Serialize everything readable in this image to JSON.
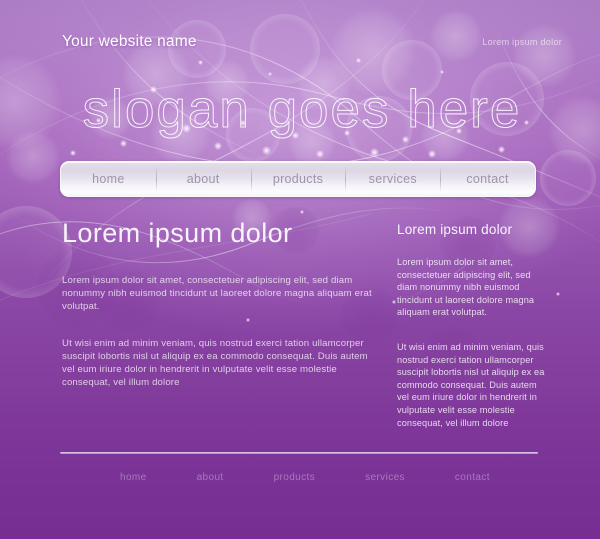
{
  "header": {
    "site_name": "Your website name",
    "tagline": "Lorem ipsum dolor"
  },
  "hero": {
    "slogan": "slogan goes here"
  },
  "nav": {
    "items": [
      {
        "label": "home"
      },
      {
        "label": "about"
      },
      {
        "label": "products"
      },
      {
        "label": "services"
      },
      {
        "label": "contact"
      }
    ]
  },
  "main": {
    "left": {
      "heading": "Lorem ipsum dolor",
      "paragraph_1": "Lorem ipsum dolor sit amet, consectetuer adipiscing elit, sed diam nonummy nibh euismod tincidunt ut laoreet dolore magna aliquam erat volutpat.",
      "paragraph_2": "Ut wisi enim ad minim veniam, quis nostrud exerci tation ullamcorper suscipit lobortis nisl ut aliquip ex ea commodo consequat. Duis autem vel eum iriure dolor in hendrerit in vulputate velit esse molestie consequat, vel illum dolore"
    },
    "right": {
      "heading": "Lorem ipsum dolor",
      "paragraph_1": "Lorem ipsum dolor sit amet, consectetuer adipiscing elit, sed diam nonummy nibh euismod tincidunt ut laoreet dolore magna aliquam erat volutpat.",
      "paragraph_2": "Ut wisi enim ad minim veniam, quis nostrud exerci tation ullamcorper suscipit lobortis nisl ut aliquip ex ea commodo consequat. Duis autem vel eum iriure dolor in hendrerit in vulputate velit esse molestie consequat, vel illum dolore"
    }
  },
  "footer": {
    "items": [
      {
        "label": "home"
      },
      {
        "label": "about"
      },
      {
        "label": "products"
      },
      {
        "label": "services"
      },
      {
        "label": "contact"
      }
    ]
  },
  "theme": {
    "bg_top": "#aa7bc3",
    "bg_bottom": "#762e93",
    "nav_text": "#9e93ab",
    "text_light": "#ffffff"
  }
}
